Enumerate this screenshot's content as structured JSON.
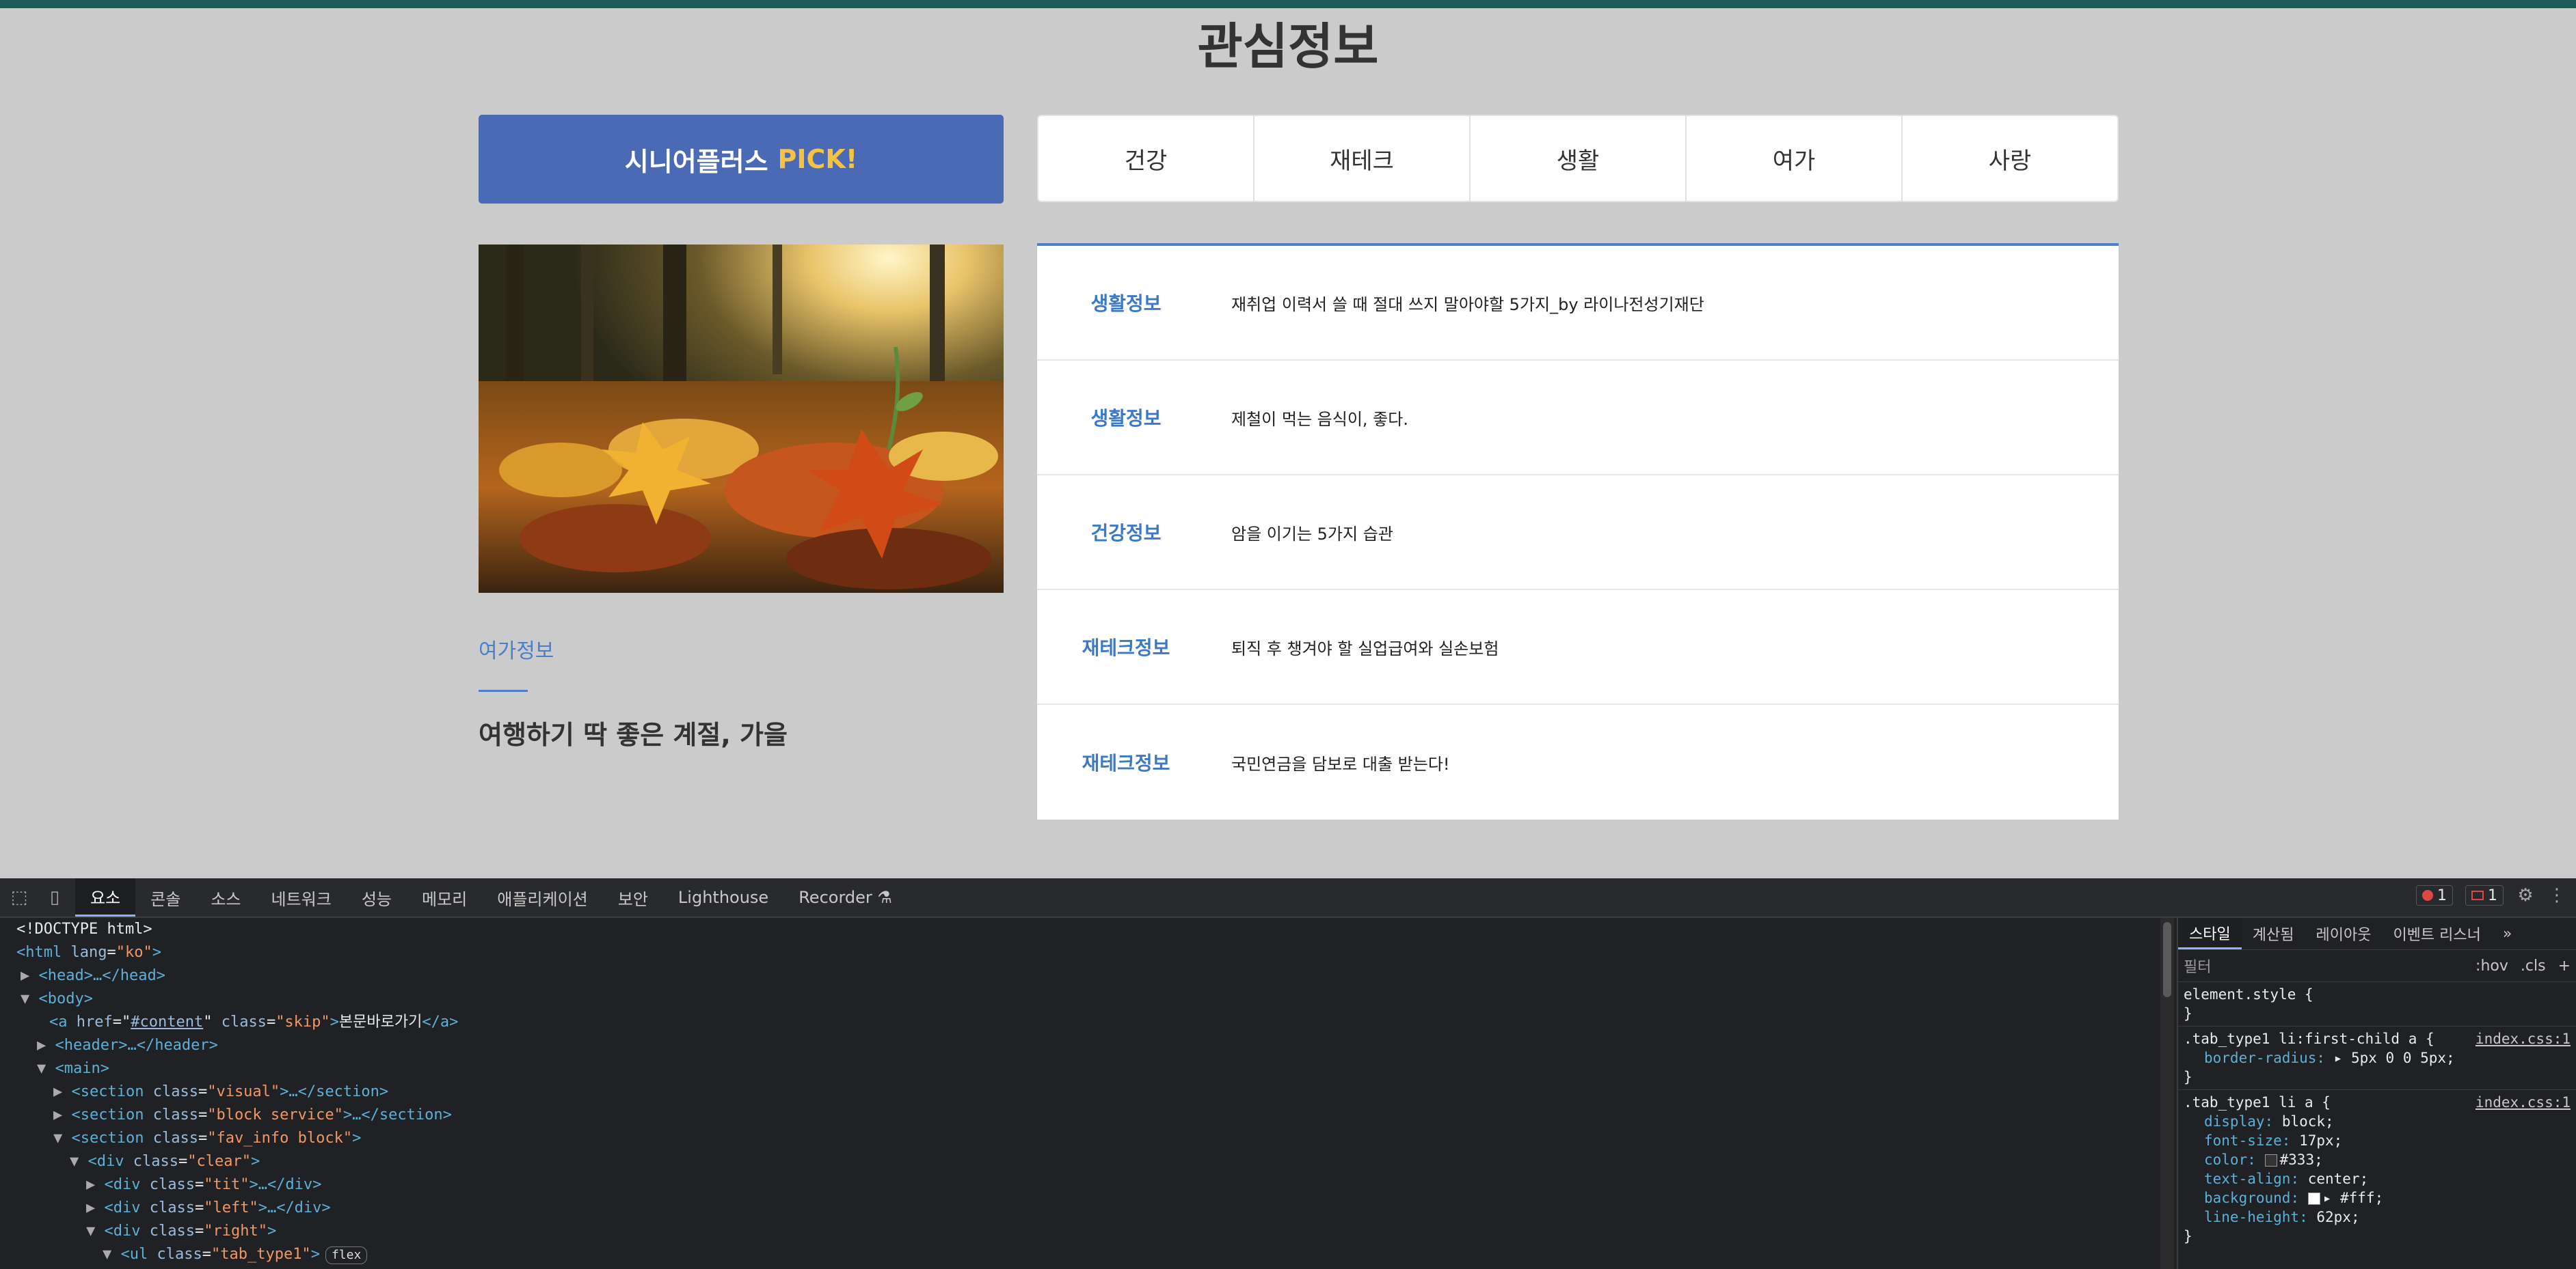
{
  "page": {
    "title": "관심정보",
    "pick_button": {
      "label": "시니어플러스",
      "highlight": "PICK!"
    },
    "tabs": [
      "건강",
      "재테크",
      "생활",
      "여가",
      "사랑"
    ],
    "feature": {
      "category": "여가정보",
      "title": "여행하기 딱 좋은 계절, 가을"
    },
    "list": [
      {
        "category": "생활정보",
        "title": "재취업 이력서 쓸 때 절대 쓰지 말아야할 5가지_by 라이나전성기재단"
      },
      {
        "category": "생활정보",
        "title": "제철이 먹는 음식이, 좋다."
      },
      {
        "category": "건강정보",
        "title": "암을 이기는 5가지 습관"
      },
      {
        "category": "재테크정보",
        "title": "퇴직 후 챙겨야 할 실업급여와 실손보험"
      },
      {
        "category": "재테크정보",
        "title": "국민연금을 담보로 대출 받는다!"
      }
    ],
    "colors": {
      "accent": "#4a7fc9",
      "pick_bg": "#4a6ab5",
      "pick_highlight": "#f5c242"
    }
  },
  "devtools": {
    "tabs": [
      "요소",
      "콘솔",
      "소스",
      "네트워크",
      "성능",
      "메모리",
      "애플리케이션",
      "보안",
      "Lighthouse",
      "Recorder ⚗"
    ],
    "errors": "1",
    "warnings": "1",
    "dom": {
      "doctype": "<!DOCTYPE html>",
      "html_open": "<html",
      "lang_attr": "lang",
      "lang_val": "\"ko\"",
      "head": "<head>…</head>",
      "body_open": "<body>",
      "a_open": "<a",
      "href_attr": "href",
      "href_val": "#content",
      "class_attr": "class",
      "skip_val": "\"skip\"",
      "skip_text": "본문바로가기",
      "a_close": "</a>",
      "header": "<header>…</header>",
      "main_open": "<main>",
      "section_visual_class": "\"visual\"",
      "section_service_class": "\"block service\"",
      "section_fav_class": "\"fav_info block\"",
      "div_clear_class": "\"clear\"",
      "div_tit_class": "\"tit\"",
      "div_left_class": "\"left\"",
      "div_right_class": "\"right\"",
      "ul_class": "\"tab_type1\"",
      "flex_badge": "flex"
    },
    "styles": {
      "tabs": [
        "스타일",
        "계산됨",
        "레이아웃",
        "이벤트 리스너",
        "»"
      ],
      "filter_placeholder": "필터",
      "hov": ":hov",
      "cls": ".cls",
      "add": "+",
      "rules": [
        {
          "selector": "element.style {",
          "source": "",
          "props": []
        },
        {
          "selector": ".tab_type1 li:first-child a {",
          "source": "index.css:1",
          "props": [
            {
              "name": "border-radius",
              "value": "▸ 5px 0 0 5px;"
            }
          ]
        },
        {
          "selector": ".tab_type1 li a {",
          "source": "index.css:1",
          "props": [
            {
              "name": "display",
              "value": "block;"
            },
            {
              "name": "font-size",
              "value": "17px;"
            },
            {
              "name": "color",
              "value": "#333;"
            },
            {
              "name": "text-align",
              "value": "center;"
            },
            {
              "name": "background",
              "value": "▸ #fff;"
            },
            {
              "name": "line-height",
              "value": "62px;"
            }
          ]
        }
      ]
    }
  }
}
